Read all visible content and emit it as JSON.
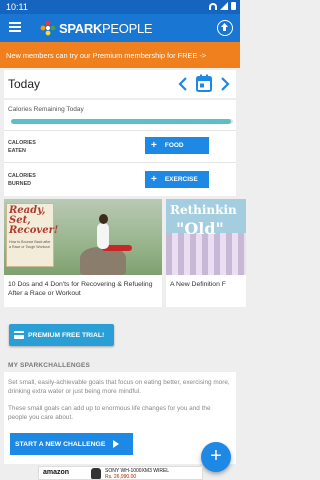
{
  "status_bar": {
    "time": "10:11"
  },
  "app": {
    "brand_bold": "SPARK",
    "brand_light": "PEOPLE",
    "menu_icon": "hamburger-icon",
    "upload_icon": "upload-circle-icon"
  },
  "promo": {
    "text": "New members can try our Premium membership for FREE ->"
  },
  "today": {
    "label": "Today"
  },
  "calories": {
    "remaining_label": "Calories Remaining Today",
    "progress_fraction": 0.99,
    "eaten_label_line1": "CALORIES",
    "eaten_label_line2": "EATEN",
    "burned_label_line1": "CALORIES",
    "burned_label_line2": "BURNED",
    "food_button": "FOOD",
    "exercise_button": "EXERCISE"
  },
  "articles": [
    {
      "title": "10 Dos and 4 Don'ts for Recovering & Refueling After a Race or Workout",
      "image_text_big": "Ready, Set, Recover!",
      "image_text_small": "How to Bounce Back after a Race or Tough Workout"
    },
    {
      "title": "A New Definition F",
      "image_text_1": "Rethinkin",
      "image_text_2": "\"Old\""
    }
  ],
  "premium_button": "PREMIUM FREE TRIAL!",
  "challenges": {
    "header": "MY SPARKCHALLENGES",
    "text1": "Set small, easily-achievable goals that focus on eating better, exercising more, drinking extra water or just being more mindful.",
    "text2": "These small goals can add up to enormous life changes for you and the people you care about.",
    "start_button": "START A NEW CHALLENGE"
  },
  "fab_label": "+",
  "ad": {
    "logo": "amazon",
    "product": "SONY WH-1000XM3 WIREL",
    "price": "Rs. 26,990.00"
  },
  "colors": {
    "primary": "#1976d2",
    "promo": "#f07f1d",
    "progress": "#5bbec8",
    "button": "#1e88e5"
  }
}
